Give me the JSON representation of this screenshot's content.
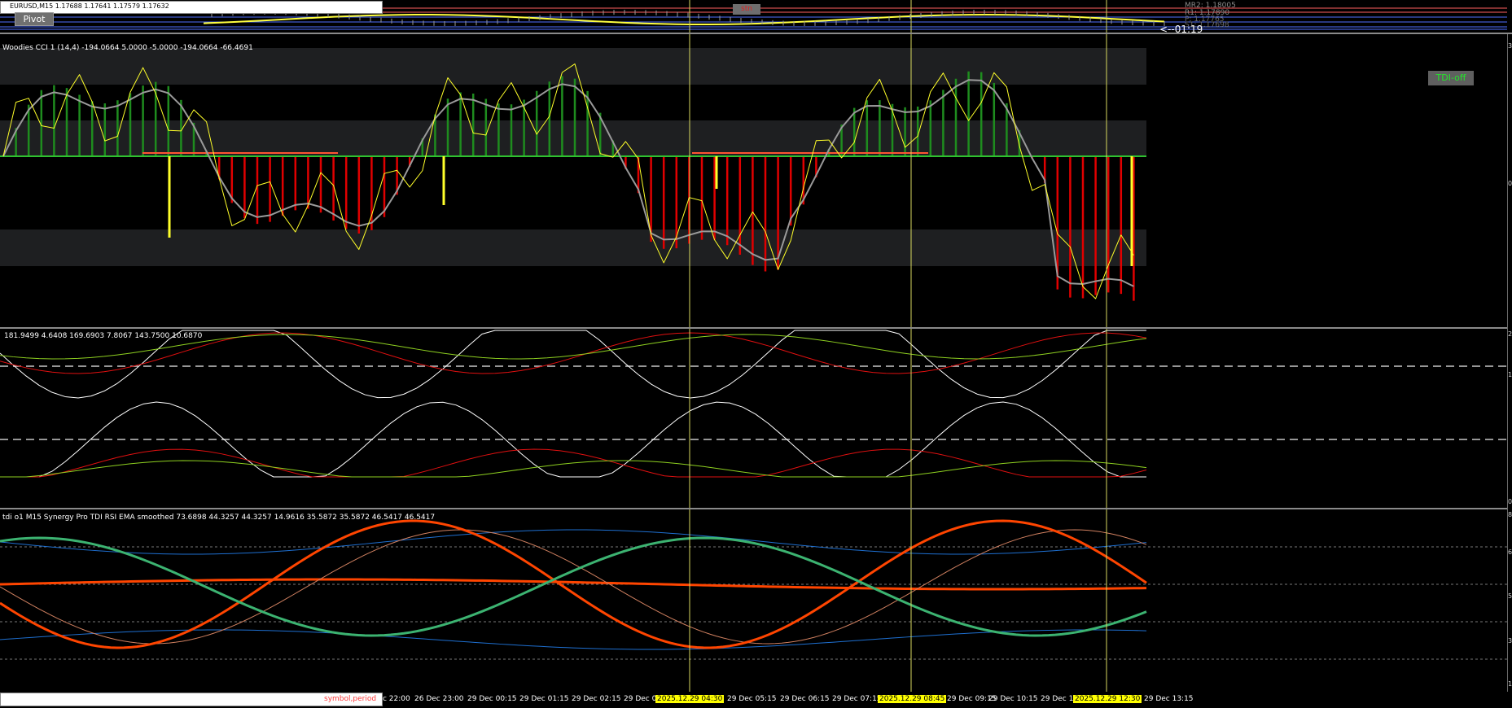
{
  "price_pane": {
    "symbol_header": "EURUSD,M15 1.17688 1.17641 1.17579 1.17632",
    "pivot_button": "Pivot",
    "badge_label": "stn",
    "levels": [
      "MR2: 1.18005",
      "R1: 1.17890",
      "P: 1.17765",
      "S1: 1.17698",
      "PP: 1.17650",
      "1.17631"
    ],
    "countdown": "<--01:19"
  },
  "cci_pane": {
    "title": "Woodies CCI 1 (14,4) -194.0664 5.0000 -5.0000 -194.0664 -66.4691",
    "tdi_button": "TDI-off",
    "scale": [
      "3",
      "0",
      "-"
    ]
  },
  "stoch_pane": {
    "title": "181.9499 4.6408 169.6903 7.8067 143.7500 10.6870",
    "scale": [
      "2",
      "1",
      "0"
    ]
  },
  "tdi_pane": {
    "title": "tdi o1 M15 Synergy Pro TDI RSI EMA smoothed  73.6898 44.3257 44.3257 14.9616 35.5872 35.5872 46.5417 46.5417",
    "scale": [
      "8",
      "6",
      "5",
      "3",
      "1"
    ]
  },
  "time_axis": {
    "input_hint": "symbol,period",
    "labels": [
      "c 22:00",
      "26 Dec 23:00",
      "29 Dec 00:15",
      "29 Dec 01:15",
      "29 Dec 02:15",
      "29 Dec 03:",
      "2025.12.29 04:30",
      "29 Dec 05:15",
      "29 Dec 06:15",
      "29 Dec 07:15",
      "2025.12.29 08:45",
      "29 Dec 09:15",
      "29 Dec 10:15",
      "29 Dec 11:",
      "2025.12.29 12:30",
      "29 Dec 13:15"
    ],
    "highlighted": [
      "2025.12.29 04:30",
      "2025.12.29 08:45",
      "2025.12.29 12:30"
    ]
  },
  "colors": {
    "cursor_lines": "#d8d860",
    "cci_up": "#1e8c1e",
    "cci_down": "#e00000",
    "cci_line": "#9a9a9a",
    "turbo_cci": "#ffff2a",
    "tdi_green": "#3cb371",
    "tdi_red": "#ff4500",
    "tdi_band": "#1e6fd0"
  }
}
